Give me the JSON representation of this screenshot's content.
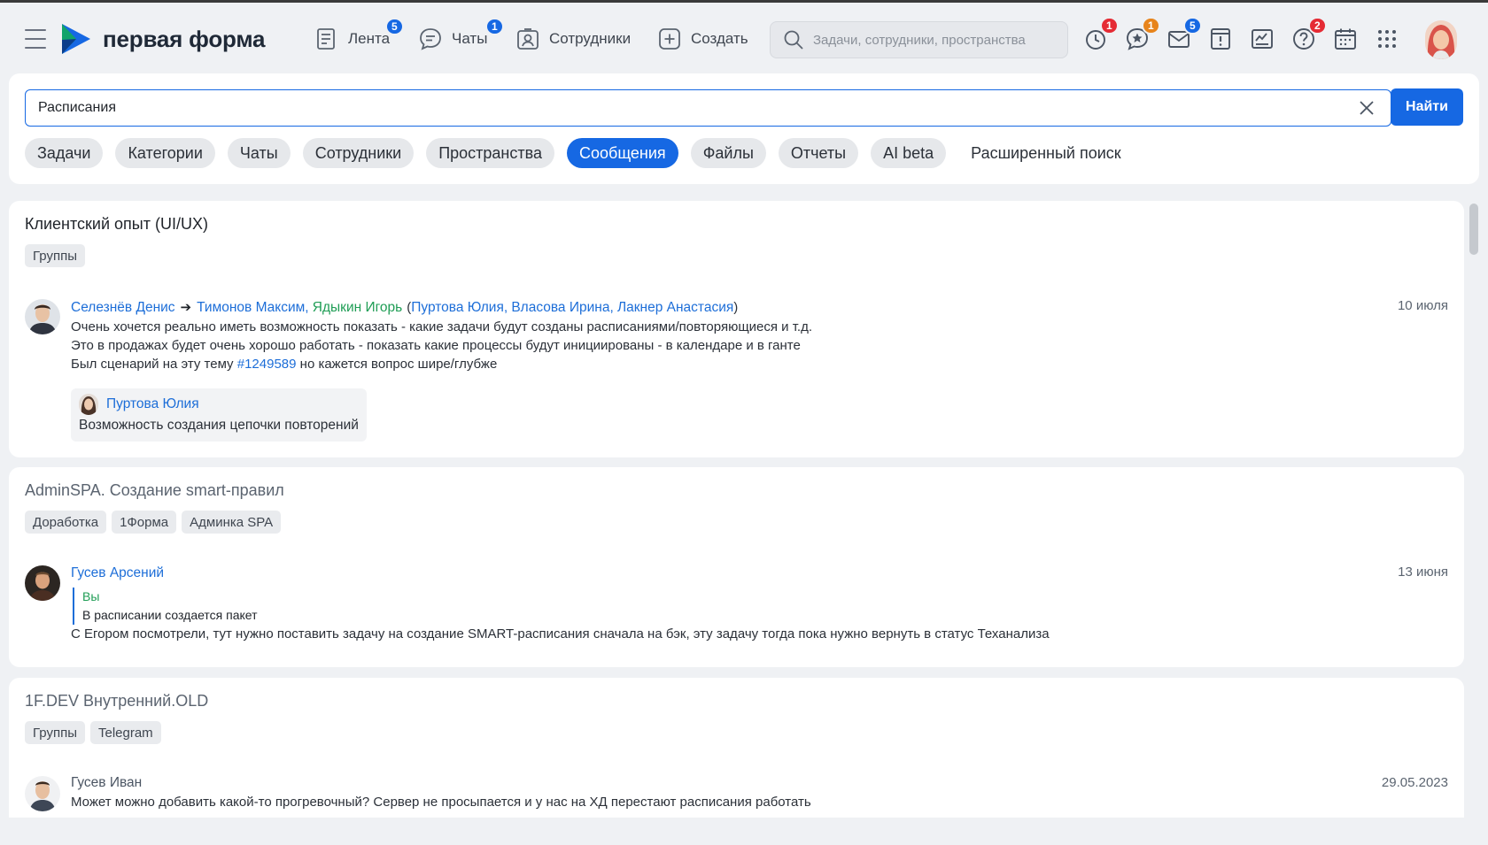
{
  "app": {
    "logo_text": "первая форма"
  },
  "nav": {
    "feed": {
      "label": "Лента",
      "badge": "5"
    },
    "chats": {
      "label": "Чаты",
      "badge": "1"
    },
    "employees": {
      "label": "Сотрудники"
    },
    "create": {
      "label": "Создать"
    }
  },
  "top_search": {
    "placeholder": "Задачи, сотрудники, пространства"
  },
  "toolbar_icons": [
    {
      "icon": "alarm-clock-icon",
      "badge": "1",
      "badge_color": "#e52b34"
    },
    {
      "icon": "star-bubble-icon",
      "badge": "1",
      "badge_color": "#e7841b"
    },
    {
      "icon": "mail-icon",
      "badge": "5",
      "badge_color": "#1668e3"
    },
    {
      "icon": "alert-document-icon"
    },
    {
      "icon": "report-icon"
    },
    {
      "icon": "help-icon",
      "badge": "2",
      "badge_color": "#e52b34"
    },
    {
      "icon": "calendar-icon"
    },
    {
      "icon": "apps-grid-icon"
    }
  ],
  "search": {
    "query": "Расписания",
    "find_label": "Найти",
    "filters": [
      "Задачи",
      "Категории",
      "Чаты",
      "Сотрудники",
      "Пространства",
      "Сообщения",
      "Файлы",
      "Отчеты",
      "AI beta"
    ],
    "active_filter": "Сообщения",
    "advanced_label": "Расширенный поиск"
  },
  "results": [
    {
      "title": "Клиентский опыт (UI/UX)",
      "tags": [
        "Группы"
      ],
      "author": "Селезнёв Денис",
      "recipients": [
        "Тимонов Максим,",
        "Ядыкин Игорь"
      ],
      "cc": [
        "Пуртова Юлия,",
        "Власова Ирина,",
        "Лакнер Анастасия"
      ],
      "date": "10 июля",
      "lines": [
        "Очень хочется реально иметь возможность показать - какие задачи будут созданы расписаниями/повторяющиеся и т.д.",
        "Это в продажах будет очень хорошо работать - показать какие процессы будут инициированы - в календаре и в ганте"
      ],
      "line3_prefix": "Был сценарий на эту тему",
      "line3_link": "#1249589",
      "line3_suffix": "но кажется вопрос шире/глубже",
      "quote": {
        "author": "Пуртова Юлия",
        "text": "Возможность создания цепочки повторений"
      }
    },
    {
      "title": "AdminSPA. Создание smart-правил",
      "tags": [
        "Доработка",
        "1Форма",
        "Админка SPA"
      ],
      "author": "Гусев Арсений",
      "date": "13 июня",
      "reply": {
        "who": "Вы",
        "text": "В расписании создается пакет"
      },
      "text": "С Егором посмотрели, тут нужно поставить задачу на создание SMART-расписания сначала на бэк, эту задачу тогда пока нужно вернуть в статус Теханализа"
    },
    {
      "title": "1F.DEV Внутренний.OLD",
      "tags": [
        "Группы",
        "Telegram"
      ],
      "author": "Гусев Иван",
      "date": "29.05.2023",
      "text": "Может можно добавить какой-то прогревочный? Сервер не просыпается и у нас на ХД перестают расписания работать"
    }
  ],
  "colors": {
    "accent": "#1668e3",
    "link": "#1d6ed8",
    "green_name": "#1f9d55",
    "page_bg": "#eff1f4"
  }
}
